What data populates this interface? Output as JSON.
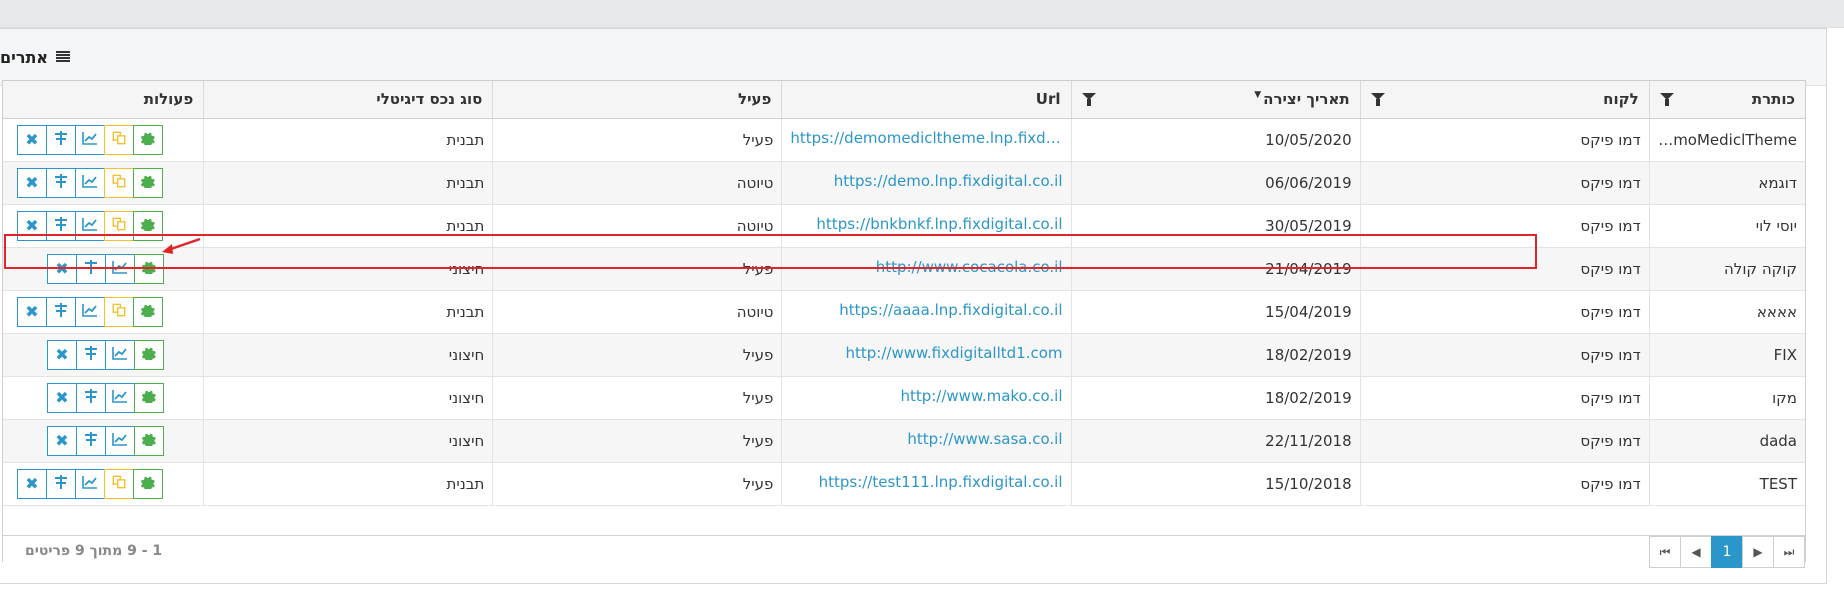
{
  "panel": {
    "title": "אתרים"
  },
  "table": {
    "headers": {
      "title": "כותרת",
      "client": "לקוח",
      "created": "תאריך יצירה",
      "url": "Url",
      "active": "פעיל",
      "asset_type": "סוג נכס דיגיטלי",
      "actions": "פעולות"
    },
    "rows": [
      {
        "title": "DemoMediclTheme",
        "client": "דמו פיקס",
        "created": "10/05/2020",
        "url": "https://demomedicltheme.lnp.fixdigit...",
        "active": "פעיל",
        "asset_type": "תבנית"
      },
      {
        "title": "דוגמא",
        "client": "דמו פיקס",
        "created": "06/06/2019",
        "url": "https://demo.lnp.fixdigital.co.il",
        "active": "טיוטה",
        "asset_type": "תבנית"
      },
      {
        "title": "יוסי לוי",
        "client": "דמו פיקס",
        "created": "30/05/2019",
        "url": "https://bnkbnkf.lnp.fixdigital.co.il",
        "active": "טיוטה",
        "asset_type": "תבנית"
      },
      {
        "title": "קוקה קולה",
        "client": "דמו פיקס",
        "created": "21/04/2019",
        "url": "http://www.cocacola.co.il",
        "active": "פעיל",
        "asset_type": "חיצוני"
      },
      {
        "title": "אאאא",
        "client": "דמו פיקס",
        "created": "15/04/2019",
        "url": "https://aaaa.lnp.fixdigital.co.il",
        "active": "טיוטה",
        "asset_type": "תבנית"
      },
      {
        "title": "FIX",
        "client": "דמו פיקס",
        "created": "18/02/2019",
        "url": "http://www.fixdigitalltd1.com",
        "active": "פעיל",
        "asset_type": "חיצוני"
      },
      {
        "title": "מקו",
        "client": "דמו פיקס",
        "created": "18/02/2019",
        "url": "http://www.mako.co.il",
        "active": "פעיל",
        "asset_type": "חיצוני"
      },
      {
        "title": "dada",
        "client": "דמו פיקס",
        "created": "22/11/2018",
        "url": "http://www.sasa.co.il",
        "active": "פעיל",
        "asset_type": "חיצוני"
      },
      {
        "title": "TEST",
        "client": "דמו פיקס",
        "created": "15/10/2018",
        "url": "https://test111.lnp.fixdigital.co.il",
        "active": "פעיל",
        "asset_type": "תבנית"
      }
    ]
  },
  "pager": {
    "current_page": "1",
    "summary": "1 - 9 מתוך 9 פריטים"
  },
  "colors": {
    "accent": "#2b96c9",
    "copy": "#f2c12e",
    "gear": "#4cae4c",
    "highlight": "#e3232a"
  }
}
